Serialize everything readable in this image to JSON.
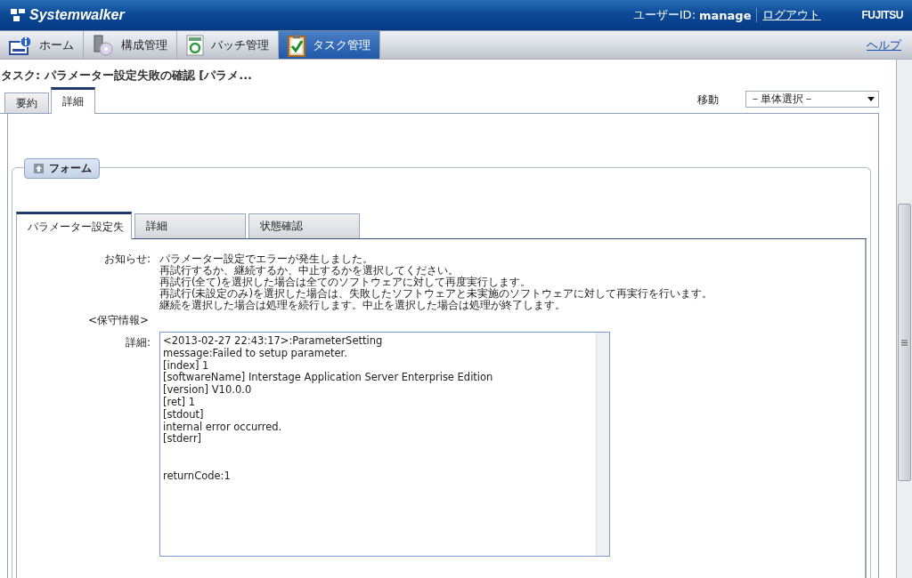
{
  "header": {
    "logo": "Systemwalker",
    "user_label": "ユーザーID:",
    "user_id": "manage",
    "logout": "ログアウト",
    "brand": "FUJITSU"
  },
  "nav": {
    "items": [
      {
        "label": "ホーム",
        "selected": false
      },
      {
        "label": "構成管理",
        "selected": false
      },
      {
        "label": "バッチ管理",
        "selected": false
      },
      {
        "label": "タスク管理",
        "selected": true
      }
    ],
    "help": "ヘルプ"
  },
  "page_title": "タスク: パラメーター設定失敗の確認 [パラメ...",
  "tabs": [
    {
      "label": "要約",
      "selected": false
    },
    {
      "label": "詳細",
      "selected": true
    }
  ],
  "move": {
    "label": "移動",
    "value": "－単体選択－"
  },
  "form": {
    "legend": "フォーム",
    "tabs": [
      {
        "label": "パラメーター設定失",
        "selected": true
      },
      {
        "label": "詳細",
        "selected": false
      },
      {
        "label": "状態確認",
        "selected": false
      }
    ],
    "notice_label": "お知らせ:",
    "notice_lines": [
      "パラメーター設定でエラーが発生しました。",
      "再試行するか、継続するか、中止するかを選択してください。",
      "再試行(全て)を選択した場合は全てのソフトウェアに対して再度実行します。",
      "再試行(未設定のみ)を選択した場合は、失敗したソフトウェアと未実施のソフトウェアに対して再実行を行います。",
      "継続を選択した場合は処理を続行します。中止を選択した場合は処理が終了します。"
    ],
    "maintenance": "<保守情報>",
    "detail_label": "詳細:",
    "detail_value": "<2013-02-27 22:43:17>:ParameterSetting\nmessage:Failed to setup parameter.\n[index] 1\n[softwareName] Interstage Application Server Enterprise Edition\n[version] V10.0.0\n[ret] 1\n[stdout]\ninternal error occurred.\n[stderr]\n\n\nreturnCode:1"
  }
}
